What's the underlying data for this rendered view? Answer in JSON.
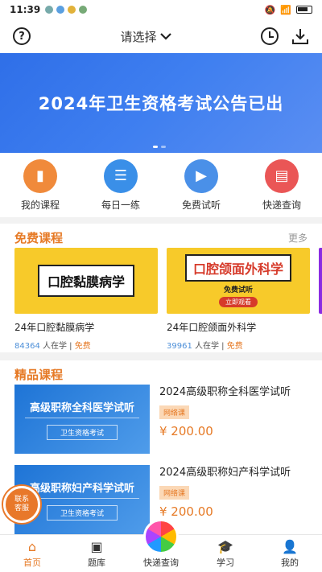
{
  "status": {
    "time": "11:39"
  },
  "header": {
    "picker_label": "请选择"
  },
  "banner": {
    "title": "2024年卫生资格考试公告已出"
  },
  "quick": [
    {
      "label": "我的课程",
      "icon": "book-icon",
      "color": "#f08a3b"
    },
    {
      "label": "每日一练",
      "icon": "practice-icon",
      "color": "#3a8fe8"
    },
    {
      "label": "免费试听",
      "icon": "video-icon",
      "color": "#4a90e8"
    },
    {
      "label": "快递查询",
      "icon": "store-icon",
      "color": "#ea5656"
    }
  ],
  "free": {
    "title": "免费课程",
    "more": "更多",
    "courses": [
      {
        "thumb_text": "口腔黏膜病学",
        "name": "24年口腔黏膜病学",
        "count": "84364",
        "count_suffix": " 人在学 | ",
        "price_tag": "免费"
      },
      {
        "thumb_text": "口腔颌面外科学",
        "thumb_sub1": "免费试听",
        "thumb_sub2": "立即观看",
        "name": "24年口腔颌面外科学",
        "count": "39961",
        "count_suffix": " 人在学 | ",
        "price_tag": "免费"
      }
    ]
  },
  "premium": {
    "title": "精品课程",
    "courses": [
      {
        "thumb_title": "高级职称全科医学试听",
        "thumb_sub": "卫生资格考试",
        "name": "2024高级职称全科医学试听",
        "tag": "网络课",
        "price": "¥ 200.00"
      },
      {
        "thumb_title": "高级职称妇产科学试听",
        "thumb_sub": "卫生资格考试",
        "name": "2024高级职称妇产科学试听",
        "tag": "网络课",
        "price": "¥ 200.00"
      }
    ]
  },
  "float_button": {
    "line1": "联系",
    "line2": "客服"
  },
  "tabbar": [
    {
      "label": "首页",
      "icon": "home-icon",
      "active": true
    },
    {
      "label": "题库",
      "icon": "question-bank-icon"
    },
    {
      "label": "快递查询",
      "icon": "express-icon"
    },
    {
      "label": "学习",
      "icon": "graduation-cap-icon"
    },
    {
      "label": "我的",
      "icon": "user-icon"
    }
  ],
  "colors": {
    "accent": "#e67a26",
    "banner": "#3a7bec"
  }
}
